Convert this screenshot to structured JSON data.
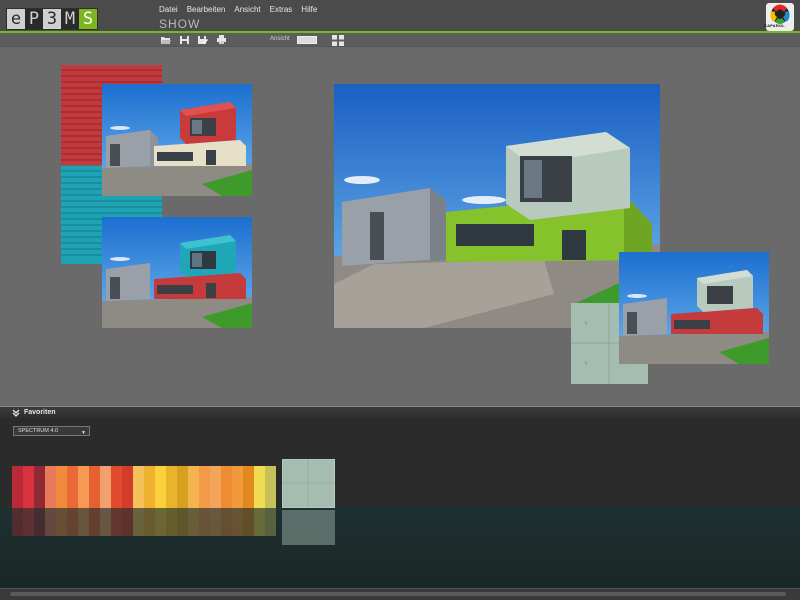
{
  "app": {
    "logo_letters": [
      "e",
      "P",
      "3",
      "M",
      "S"
    ],
    "mode": "SHOW",
    "brand": "CAPAROL"
  },
  "menu": {
    "items": [
      "Datei",
      "Bearbeiten",
      "Ansicht",
      "Extras",
      "Hilfe"
    ]
  },
  "toolbar": {
    "view_label": "Ansicht",
    "icons": [
      "open-folder-icon",
      "save-icon",
      "save-as-icon",
      "print-icon",
      "filmstrip-view-icon",
      "grid-view-icon"
    ]
  },
  "favorites": {
    "title": "Favoriten",
    "collection": "SPECTRUM 4.0",
    "swatches": [
      "#b82a36",
      "#d7323e",
      "#8e2a33",
      "#e8795a",
      "#f08a3f",
      "#e96a35",
      "#f49a55",
      "#e56130",
      "#f2a070",
      "#e24a2e",
      "#d23c2a",
      "#f6c05a",
      "#f0b030",
      "#fbd03a",
      "#e8b52a",
      "#d7a020",
      "#f4b44d",
      "#f29a48",
      "#f2a55a",
      "#ef8a35",
      "#f09a3c",
      "#e1891e",
      "#f0dc50",
      "#c8c15a"
    ]
  },
  "colors": {
    "accent_green": "#7bb51f",
    "header_bg": "#4b4b4b",
    "canvas_bg": "#6a6a6a"
  }
}
